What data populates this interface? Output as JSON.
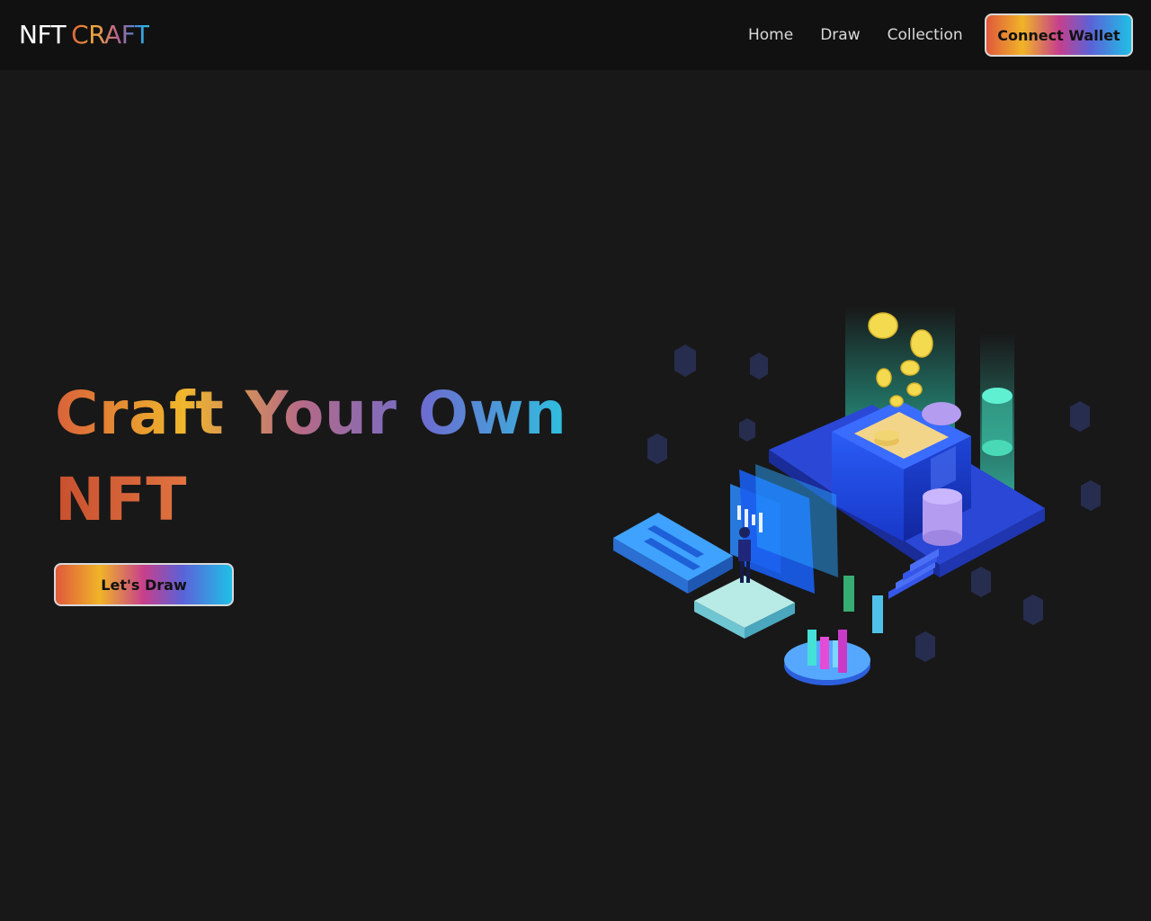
{
  "header": {
    "logo_part1": "NFT",
    "logo_part2": "CRAFT",
    "nav": [
      {
        "label": "Home"
      },
      {
        "label": "Draw"
      },
      {
        "label": "Collection"
      }
    ],
    "connect_label": "Connect Wallet"
  },
  "hero": {
    "title_line1": "Craft Your Own",
    "title_line2": "NFT",
    "cta_label": "Let's Draw"
  },
  "illustration": {
    "icon": "isometric-blockchain-illustration"
  },
  "colors": {
    "background": "#181818",
    "header": "#111111",
    "gradient": [
      "#e0593c",
      "#f0b428",
      "#c73f8c",
      "#5b62d8",
      "#1fc0e6"
    ]
  }
}
